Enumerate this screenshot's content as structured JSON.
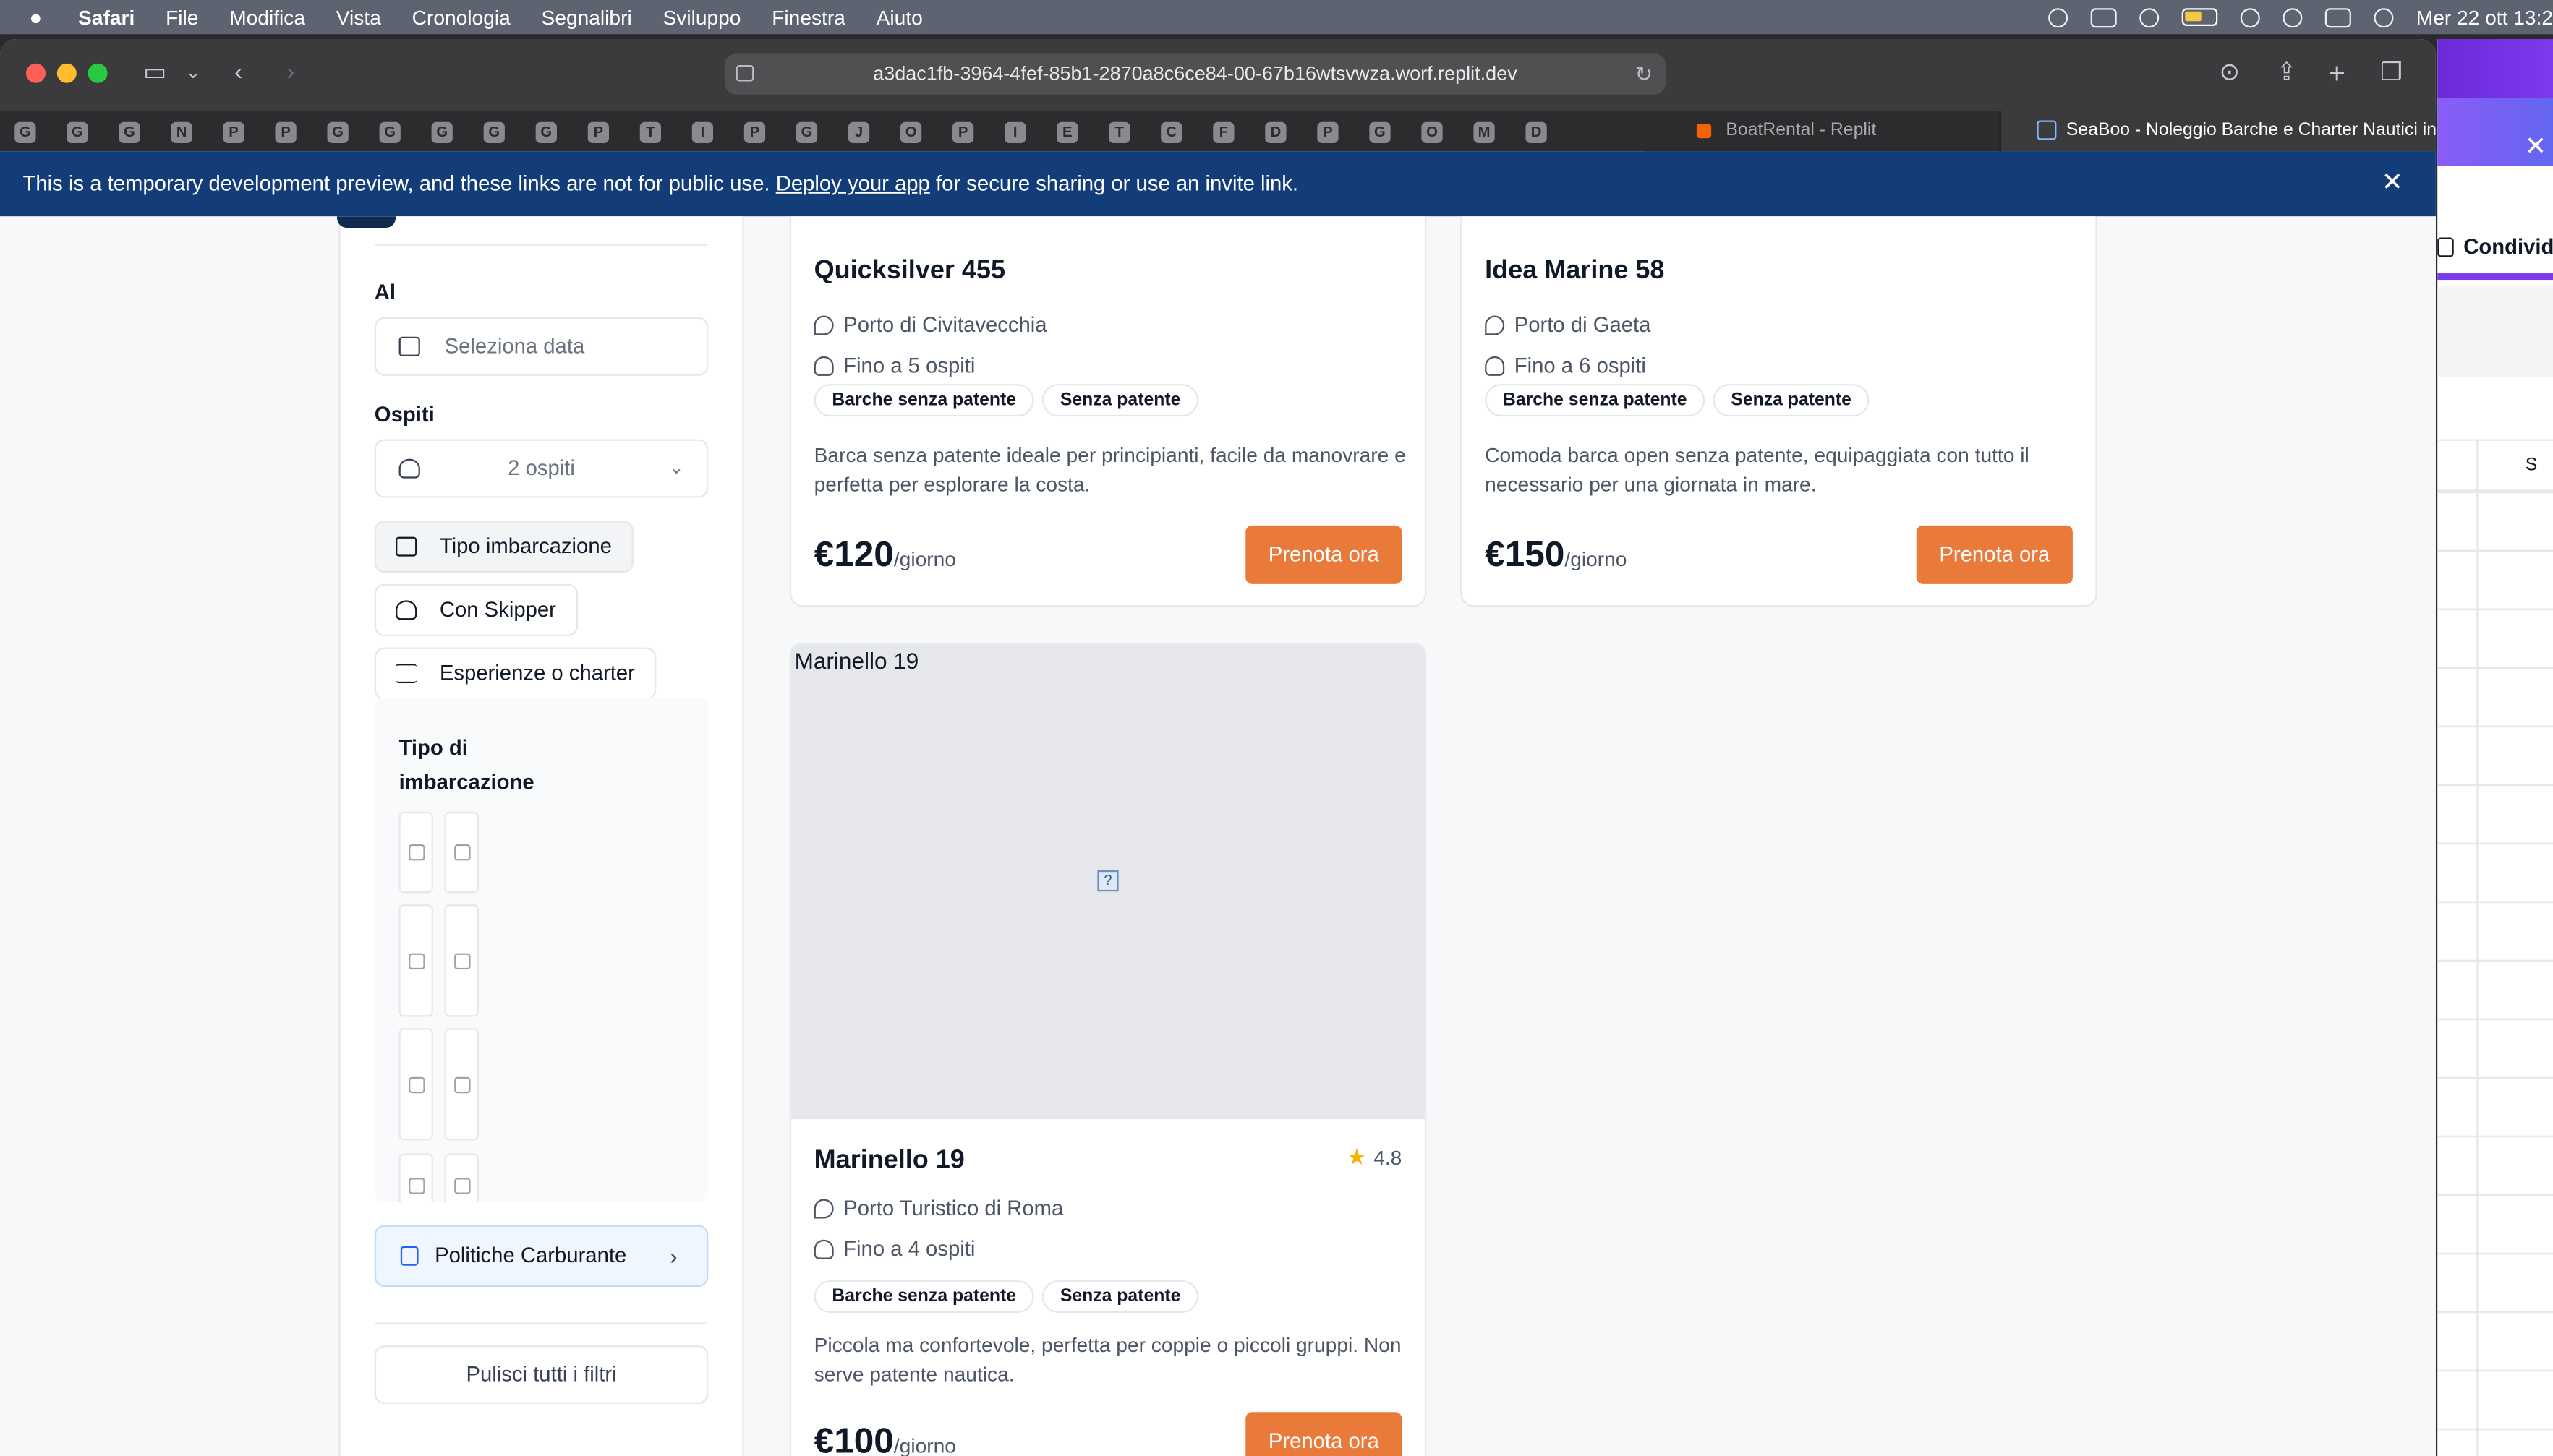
{
  "menubar": {
    "app": "Safari",
    "items": [
      "File",
      "Modifica",
      "Vista",
      "Cronologia",
      "Segnalibri",
      "Sviluppo",
      "Finestra",
      "Aiuto"
    ],
    "clock": "Mer 22 ott  13:2"
  },
  "browser": {
    "url": "a3dac1fb-3964-4fef-85b1-2870a8c6ce84-00-67b16wtsvwza.worf.replit.dev",
    "favicons": [
      "G",
      "G",
      "G",
      "N",
      "P",
      "P",
      "G",
      "G",
      "G",
      "G",
      "G",
      "P",
      "T",
      "I",
      "P",
      "G",
      "J",
      "O",
      "P",
      "I",
      "E",
      "T",
      "C",
      "F",
      "D",
      "P",
      "G",
      "O",
      "M",
      "D"
    ],
    "tabs": [
      {
        "title": "BoatRental - Replit"
      },
      {
        "title": "SeaBoo - Noleggio Barche e Charter Nautici in..."
      }
    ]
  },
  "banner": {
    "text_before": "This is a temporary development preview, and these links are not for public use.",
    "link": "Deploy your app",
    "text_after": "for secure sharing or use an invite link."
  },
  "filters": {
    "date_to_label": "Al",
    "date_placeholder": "Seleziona data",
    "guests_label": "Ospiti",
    "guests_value": "2 ospiti",
    "pills": [
      {
        "label": "Tipo imbarcazione",
        "active": true
      },
      {
        "label": "Con Skipper",
        "active": false
      },
      {
        "label": "Esperienze o charter",
        "active": false
      }
    ],
    "boat_type_title": "Tipo di imbarcazione",
    "fuel_button": "Politiche Carburante",
    "clear_button": "Pulisci tutti i filtri"
  },
  "boats": [
    {
      "name": "Quicksilver 455",
      "location": "Porto di Civitavecchia",
      "guests": "Fino a 5 ospiti",
      "tags": [
        "Barche senza patente",
        "Senza patente"
      ],
      "description": "Barca senza patente ideale per principianti, facile da manovrare e perfetta per esplorare la costa.",
      "price": "€120",
      "unit": "/giorno",
      "cta": "Prenota ora"
    },
    {
      "name": "Idea Marine 58",
      "location": "Porto di Gaeta",
      "guests": "Fino a 6 ospiti",
      "tags": [
        "Barche senza patente",
        "Senza patente"
      ],
      "description": "Comoda barca open senza patente, equipaggiata con tutto il necessario per una giornata in mare.",
      "price": "€150",
      "unit": "/giorno",
      "cta": "Prenota ora"
    },
    {
      "name": "Marinello 19",
      "image_alt": "Marinello 19",
      "rating": "4.8",
      "location": "Porto Turistico di Roma",
      "guests": "Fino a 4 ospiti",
      "tags": [
        "Barche senza patente",
        "Senza patente"
      ],
      "description": "Piccola ma confortevole, perfetta per coppie o piccoli gruppi. Non serve patente nautica.",
      "price": "€100",
      "unit": "/giorno",
      "cta": "Prenota ora"
    }
  ],
  "side_window": {
    "share": "Condivid",
    "column": "S"
  }
}
